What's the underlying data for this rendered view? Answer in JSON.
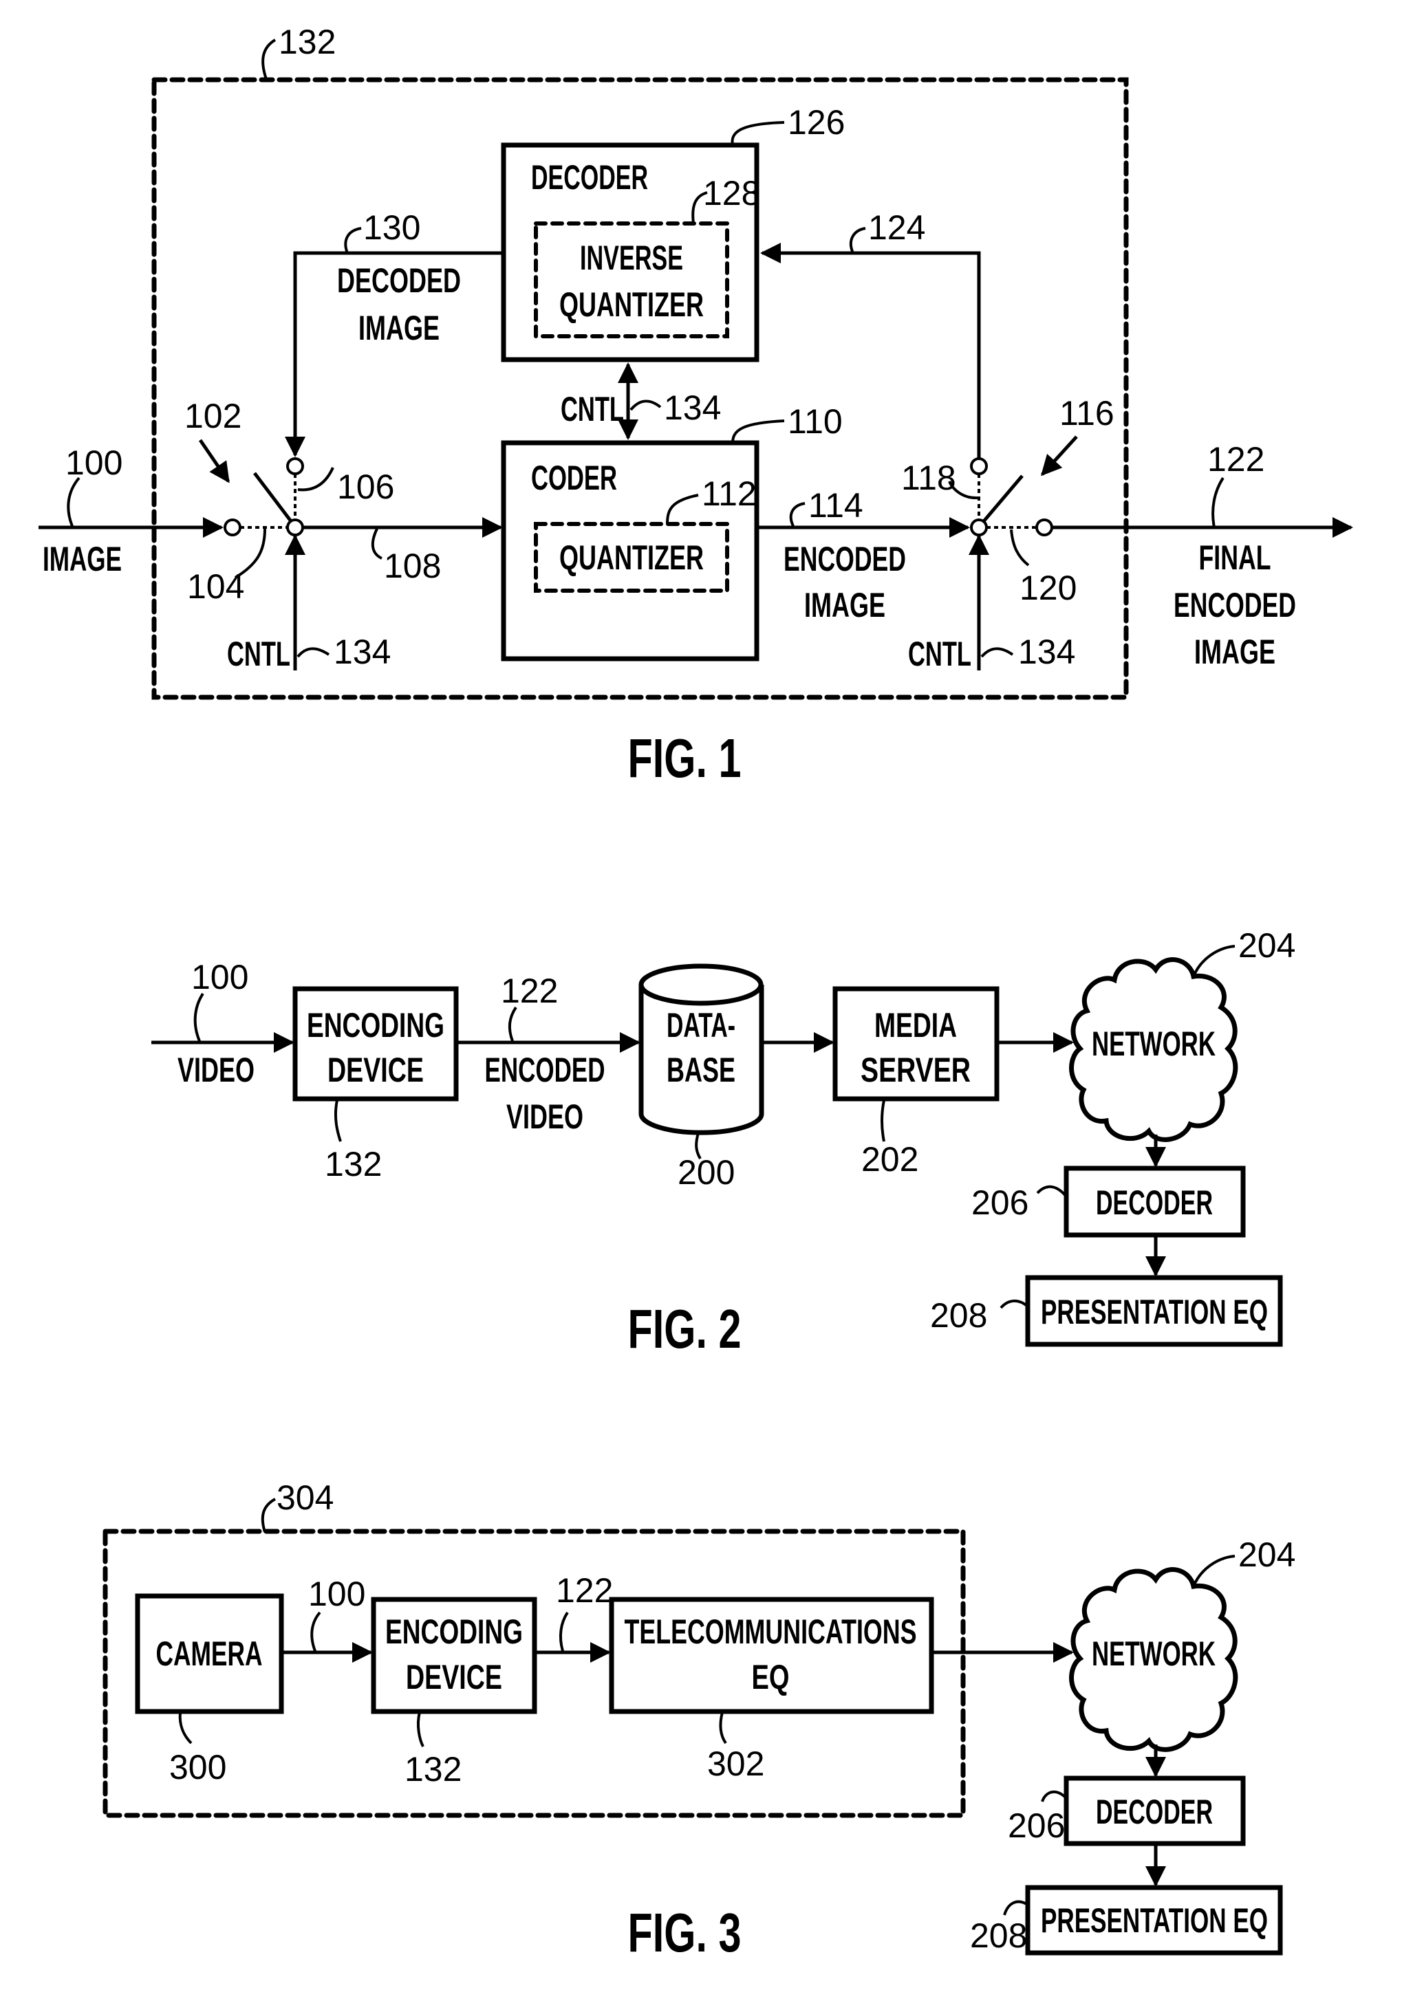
{
  "fig1": {
    "caption": "FIG. 1",
    "encoding_device_ref": "132",
    "decoder": {
      "label": "DECODER",
      "ref": "126",
      "inverse_quantizer": {
        "line1": "INVERSE",
        "line2": "QUANTIZER",
        "ref": "128"
      }
    },
    "coder": {
      "label": "CODER",
      "ref": "110",
      "quantizer": {
        "label": "QUANTIZER",
        "ref": "112"
      }
    },
    "cntl_label": "CNTL",
    "cntl_ref": "134",
    "input": {
      "label": "IMAGE",
      "ref": "100"
    },
    "switch_in": {
      "ref": "102",
      "contact_a_ref": "104",
      "contact_b_ref": "106",
      "out_ref": "108"
    },
    "decoded_image": {
      "line1": "DECODED",
      "line2": "IMAGE",
      "ref": "130"
    },
    "encoded_image": {
      "line1": "ENCODED",
      "line2": "IMAGE",
      "ref": "114"
    },
    "switch_out": {
      "ref": "116",
      "contact_a_ref": "118",
      "contact_b_ref": "120"
    },
    "feedback_ref": "124",
    "output": {
      "line1": "FINAL",
      "line2": "ENCODED",
      "line3": "IMAGE",
      "ref": "122"
    }
  },
  "fig2": {
    "caption": "FIG. 2",
    "input": {
      "label": "VIDEO",
      "ref": "100"
    },
    "encoding_device": {
      "line1": "ENCODING",
      "line2": "DEVICE",
      "ref": "132"
    },
    "encoded_video": {
      "line1": "ENCODED",
      "line2": "VIDEO",
      "ref": "122"
    },
    "database": {
      "line1": "DATA-",
      "line2": "BASE",
      "ref": "200"
    },
    "media_server": {
      "line1": "MEDIA",
      "line2": "SERVER",
      "ref": "202"
    },
    "network": {
      "label": "NETWORK",
      "ref": "204"
    },
    "decoder": {
      "label": "DECODER",
      "ref": "206"
    },
    "presentation": {
      "label": "PRESENTATION EQ",
      "ref": "208"
    }
  },
  "fig3": {
    "caption": "FIG. 3",
    "system_ref": "304",
    "camera": {
      "label": "CAMERA",
      "ref": "300"
    },
    "video_ref": "100",
    "encoding_device": {
      "line1": "ENCODING",
      "line2": "DEVICE",
      "ref": "132"
    },
    "encoded_ref": "122",
    "telecom": {
      "line1": "TELECOMMUNICATIONS",
      "line2": "EQ",
      "ref": "302"
    },
    "network": {
      "label": "NETWORK",
      "ref": "204"
    },
    "decoder": {
      "label": "DECODER",
      "ref": "206"
    },
    "presentation": {
      "label": "PRESENTATION EQ",
      "ref": "208"
    }
  }
}
